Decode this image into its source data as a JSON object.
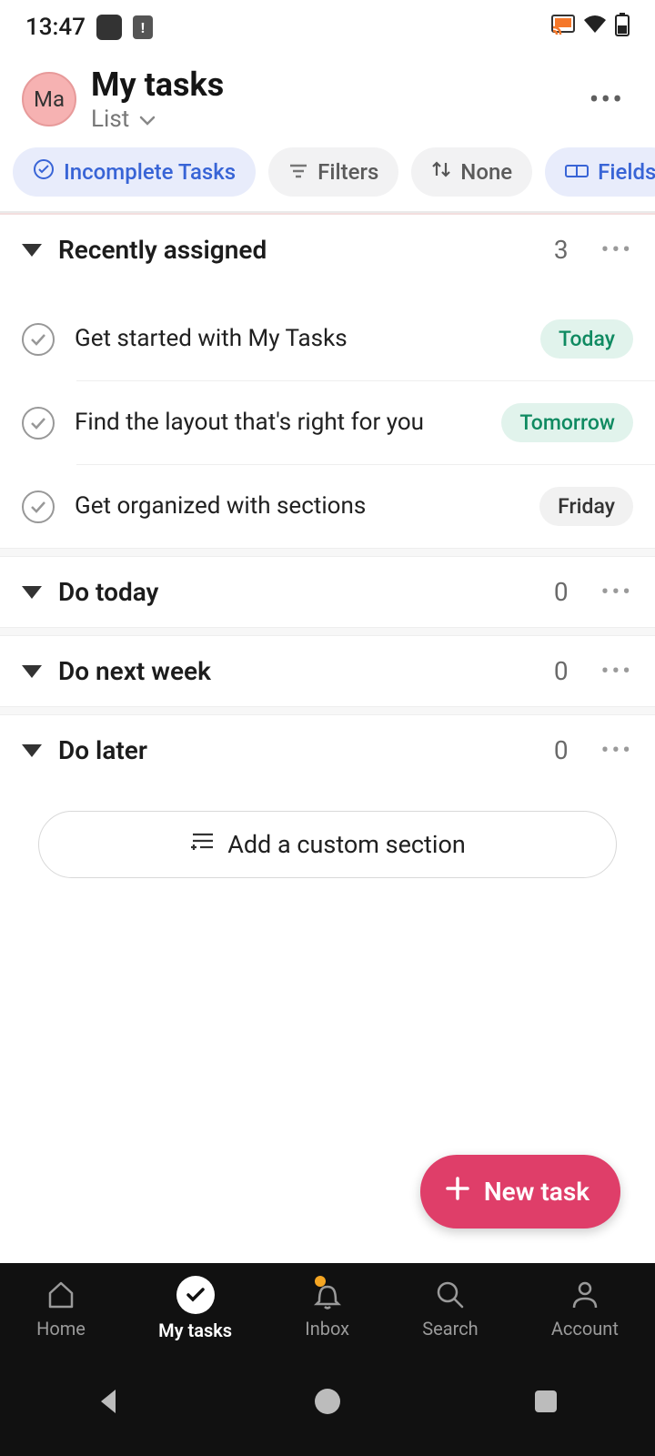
{
  "status": {
    "time": "13:47"
  },
  "header": {
    "avatar_initials": "Ma",
    "title": "My tasks",
    "view_label": "List"
  },
  "chips": {
    "incomplete": "Incomplete Tasks",
    "filters": "Filters",
    "sort": "None",
    "fields": "Fields"
  },
  "sections": [
    {
      "title": "Recently assigned",
      "count": "3"
    },
    {
      "title": "Do today",
      "count": "0"
    },
    {
      "title": "Do next week",
      "count": "0"
    },
    {
      "title": "Do later",
      "count": "0"
    }
  ],
  "tasks": [
    {
      "title": "Get started with My Tasks",
      "due": "Today",
      "badge_style": "green"
    },
    {
      "title": "Find the layout that's right for you",
      "due": "Tomorrow",
      "badge_style": "green"
    },
    {
      "title": "Get organized with sections",
      "due": "Friday",
      "badge_style": "gray"
    }
  ],
  "add_section_label": "Add a custom section",
  "fab_label": "New task",
  "nav": {
    "home": "Home",
    "mytasks": "My tasks",
    "inbox": "Inbox",
    "search": "Search",
    "account": "Account"
  }
}
